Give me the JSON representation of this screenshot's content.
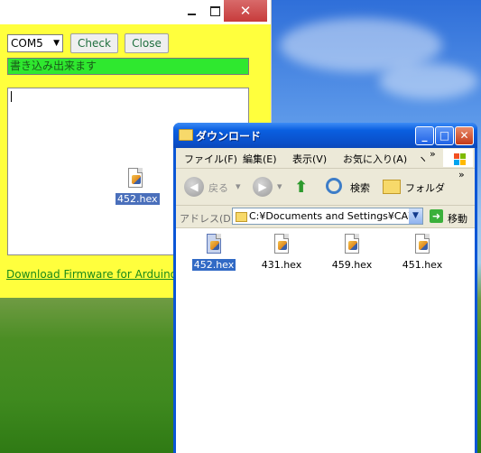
{
  "app": {
    "com_port": "COM5",
    "check_label": "Check",
    "close_label": "Close",
    "status_text": "書き込み出来ます",
    "download_link": "Download Firmware for Arduino",
    "close_glyph": "✕"
  },
  "dragged_file": {
    "name": "452.hex",
    "icon": "hex-file-icon"
  },
  "explorer": {
    "title": "ダウンロード",
    "menu": [
      "ファイル(F)",
      "編集(E)",
      "表示(V)",
      "お気に入り(A)",
      "ヽ",
      "»"
    ],
    "toolbar": {
      "back_label": "戻る",
      "search_label": "検索",
      "folder_label": "フォルダ",
      "more": "»"
    },
    "address_label": "アドレス(D)",
    "address_value": "C:¥Documents and Settings¥CA¥",
    "go_label": "移動",
    "files": [
      {
        "name": "452.hex",
        "selected": true
      },
      {
        "name": "431.hex",
        "selected": false
      },
      {
        "name": "459.hex",
        "selected": false
      },
      {
        "name": "451.hex",
        "selected": false
      }
    ]
  },
  "colors": {
    "app_bg": "#ffff3d",
    "status_bg": "#2fe82f",
    "link": "#1a8a1a",
    "xp_title": "#0a56d6",
    "selection": "#316ac5"
  }
}
